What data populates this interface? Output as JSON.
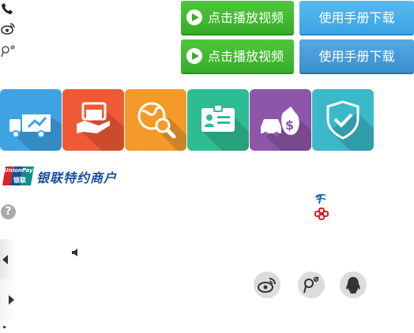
{
  "buttons": {
    "play_video_1": "点击播放视频",
    "play_video_2": "点击播放视频",
    "manual_download_1": "使用手册下载",
    "manual_download_2": "使用手册下载"
  },
  "icons": {
    "phone": "phone-icon",
    "weibo": "weibo-icon",
    "tencent_weibo": "tencent-weibo-icon",
    "logistics": "delivery-truck-icon",
    "payment": "hand-card-icon",
    "global_search": "globe-search-icon",
    "id_card": "id-card-icon",
    "car_finance": "car-money-icon",
    "security": "shield-check-icon",
    "help": "question-icon",
    "speaker": "speaker-icon",
    "china_telecom": "china-telecom-icon",
    "china_unicom": "china-unicom-icon",
    "qq": "qq-icon"
  },
  "tiles": [
    {
      "color": "#3fa3e3"
    },
    {
      "color": "#ef5a35"
    },
    {
      "color": "#f39a2b"
    },
    {
      "color": "#2ebd92"
    },
    {
      "color": "#8e56a8"
    },
    {
      "color": "#3bb9c8"
    }
  ],
  "unionpay": {
    "logo_top": "UnionPay",
    "logo_bottom": "银联",
    "label": "银联特约商户"
  },
  "help": {
    "symbol": "?"
  }
}
